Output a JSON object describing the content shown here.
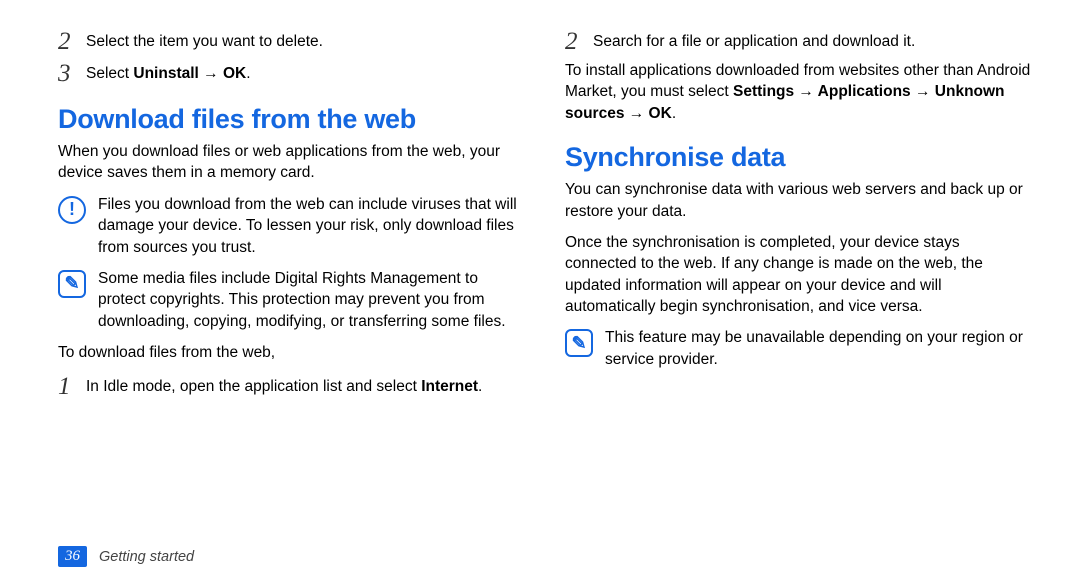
{
  "col_left": {
    "step2": "Select the item you want to delete.",
    "step3_prefix": "Select ",
    "step3_bold": "Uninstall → OK",
    "step3_suffix": ".",
    "heading": "Download files from the web",
    "intro": "When you download files or web applications from the web, your device saves them in a memory card.",
    "warn": "Files you download from the web can include viruses that will damage your device. To lessen your risk, only download files from sources you trust.",
    "drm": "Some media files include Digital Rights Management to protect copyrights. This protection may prevent you from downloading, copying, modifying, or transferring some files.",
    "todownload": "To download files from the web,",
    "step1_prefix": "In Idle mode, open the application list and select ",
    "step1_bold": "Internet",
    "step1_suffix": "."
  },
  "col_right": {
    "step2": "Search for a file or application and download it.",
    "install_prefix": "To install applications downloaded from websites other than Android Market, you must select ",
    "install_bold": "Settings → Applications → Unknown sources → OK",
    "install_suffix": ".",
    "heading": "Synchronise data",
    "sync1": "You can synchronise data with various web servers and back up or restore your data.",
    "sync2": "Once the synchronisation is completed, your device stays connected to the web. If any change is made on the web, the updated information will appear on your device and will automatically begin synchronisation, and vice versa.",
    "sync_note": "This feature may be unavailable depending on your region or service provider."
  },
  "footer": {
    "page": "36",
    "section": "Getting started"
  },
  "nums": {
    "n1": "1",
    "n2": "2",
    "n3": "3"
  },
  "icons": {
    "warn": "!",
    "note": "✎"
  }
}
